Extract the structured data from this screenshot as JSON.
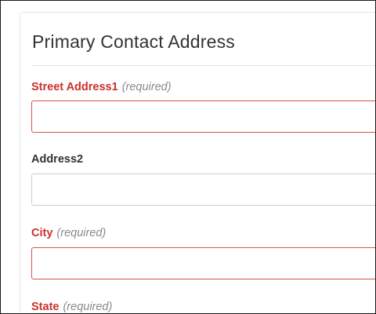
{
  "panel": {
    "title": "Primary Contact Address"
  },
  "fields": {
    "street1": {
      "label": "Street Address1",
      "note": "(required)",
      "value": ""
    },
    "address2": {
      "label": "Address2",
      "value": ""
    },
    "city": {
      "label": "City",
      "note": "(required)",
      "value": ""
    },
    "state": {
      "label": "State",
      "note": "(required)"
    }
  },
  "colors": {
    "required_label": "#c9302c",
    "required_border": "#d9534f",
    "optional_border": "#cccccc",
    "note_text": "#8a8a8a"
  }
}
